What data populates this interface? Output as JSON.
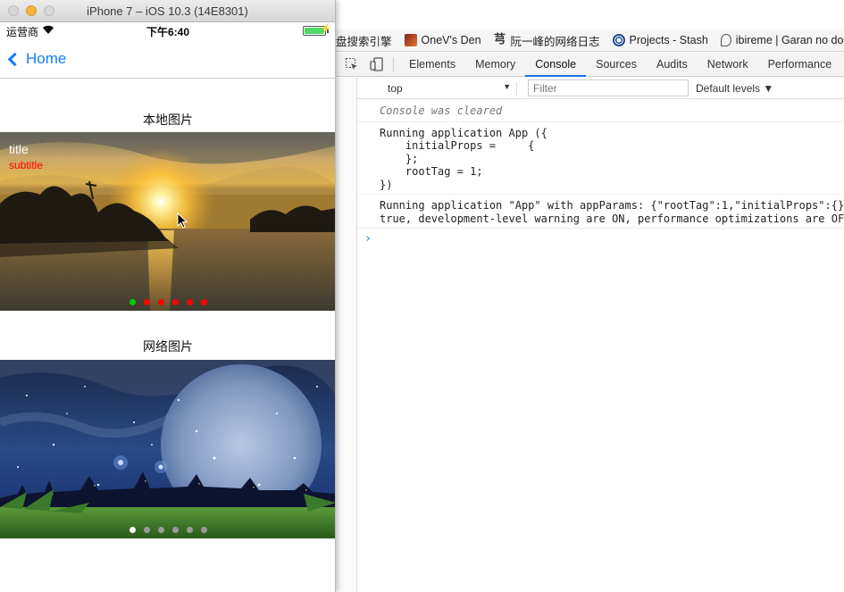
{
  "simulator": {
    "window_title": "iPhone 7 – iOS 10.3 (14E8301)",
    "status": {
      "carrier": "运营商",
      "time": "下午6:40",
      "charging": "⚡"
    },
    "navbar": {
      "back_label": "Home"
    },
    "sections": {
      "local": {
        "title": "本地图片",
        "caption_title": "title",
        "caption_subtitle": "subtitle",
        "page_count": 6,
        "current_page": 1,
        "dot_active_color": "#00cc00",
        "dot_inactive_color": "#ff0000"
      },
      "network": {
        "title": "网络图片",
        "page_count": 6,
        "current_page": 1,
        "dot_active_color": "#ffffff",
        "dot_inactive_color": "#9a9a9a"
      }
    }
  },
  "browser": {
    "bookmarks": [
      {
        "label": "盘搜索引擎",
        "icon": "none"
      },
      {
        "label": "OneV's Den",
        "icon": "onev-favicon"
      },
      {
        "label": "阮一峰的网络日志",
        "icon": "ruanyifeng-favicon"
      },
      {
        "label": "Projects - Stash",
        "icon": "stash-icon"
      },
      {
        "label": "ibireme | Garan no do",
        "icon": "ibireme-icon"
      }
    ],
    "devtools": {
      "tabs": [
        "Elements",
        "Memory",
        "Console",
        "Sources",
        "Audits",
        "Network",
        "Performance"
      ],
      "active_tab": "Console",
      "context": "top",
      "filter_placeholder": "Filter",
      "levels": "Default levels ▼",
      "console_cleared": "Console was cleared",
      "log1": "Running application App ({\n    initialProps =     {\n    };\n    rootTag = 1;\n})",
      "log2": "Running application \"App\" with appParams: {\"rootTag\":1,\"initialProps\":{}}\ntrue, development-level warning are ON, performance optimizations are OFF",
      "prompt": "›"
    }
  }
}
